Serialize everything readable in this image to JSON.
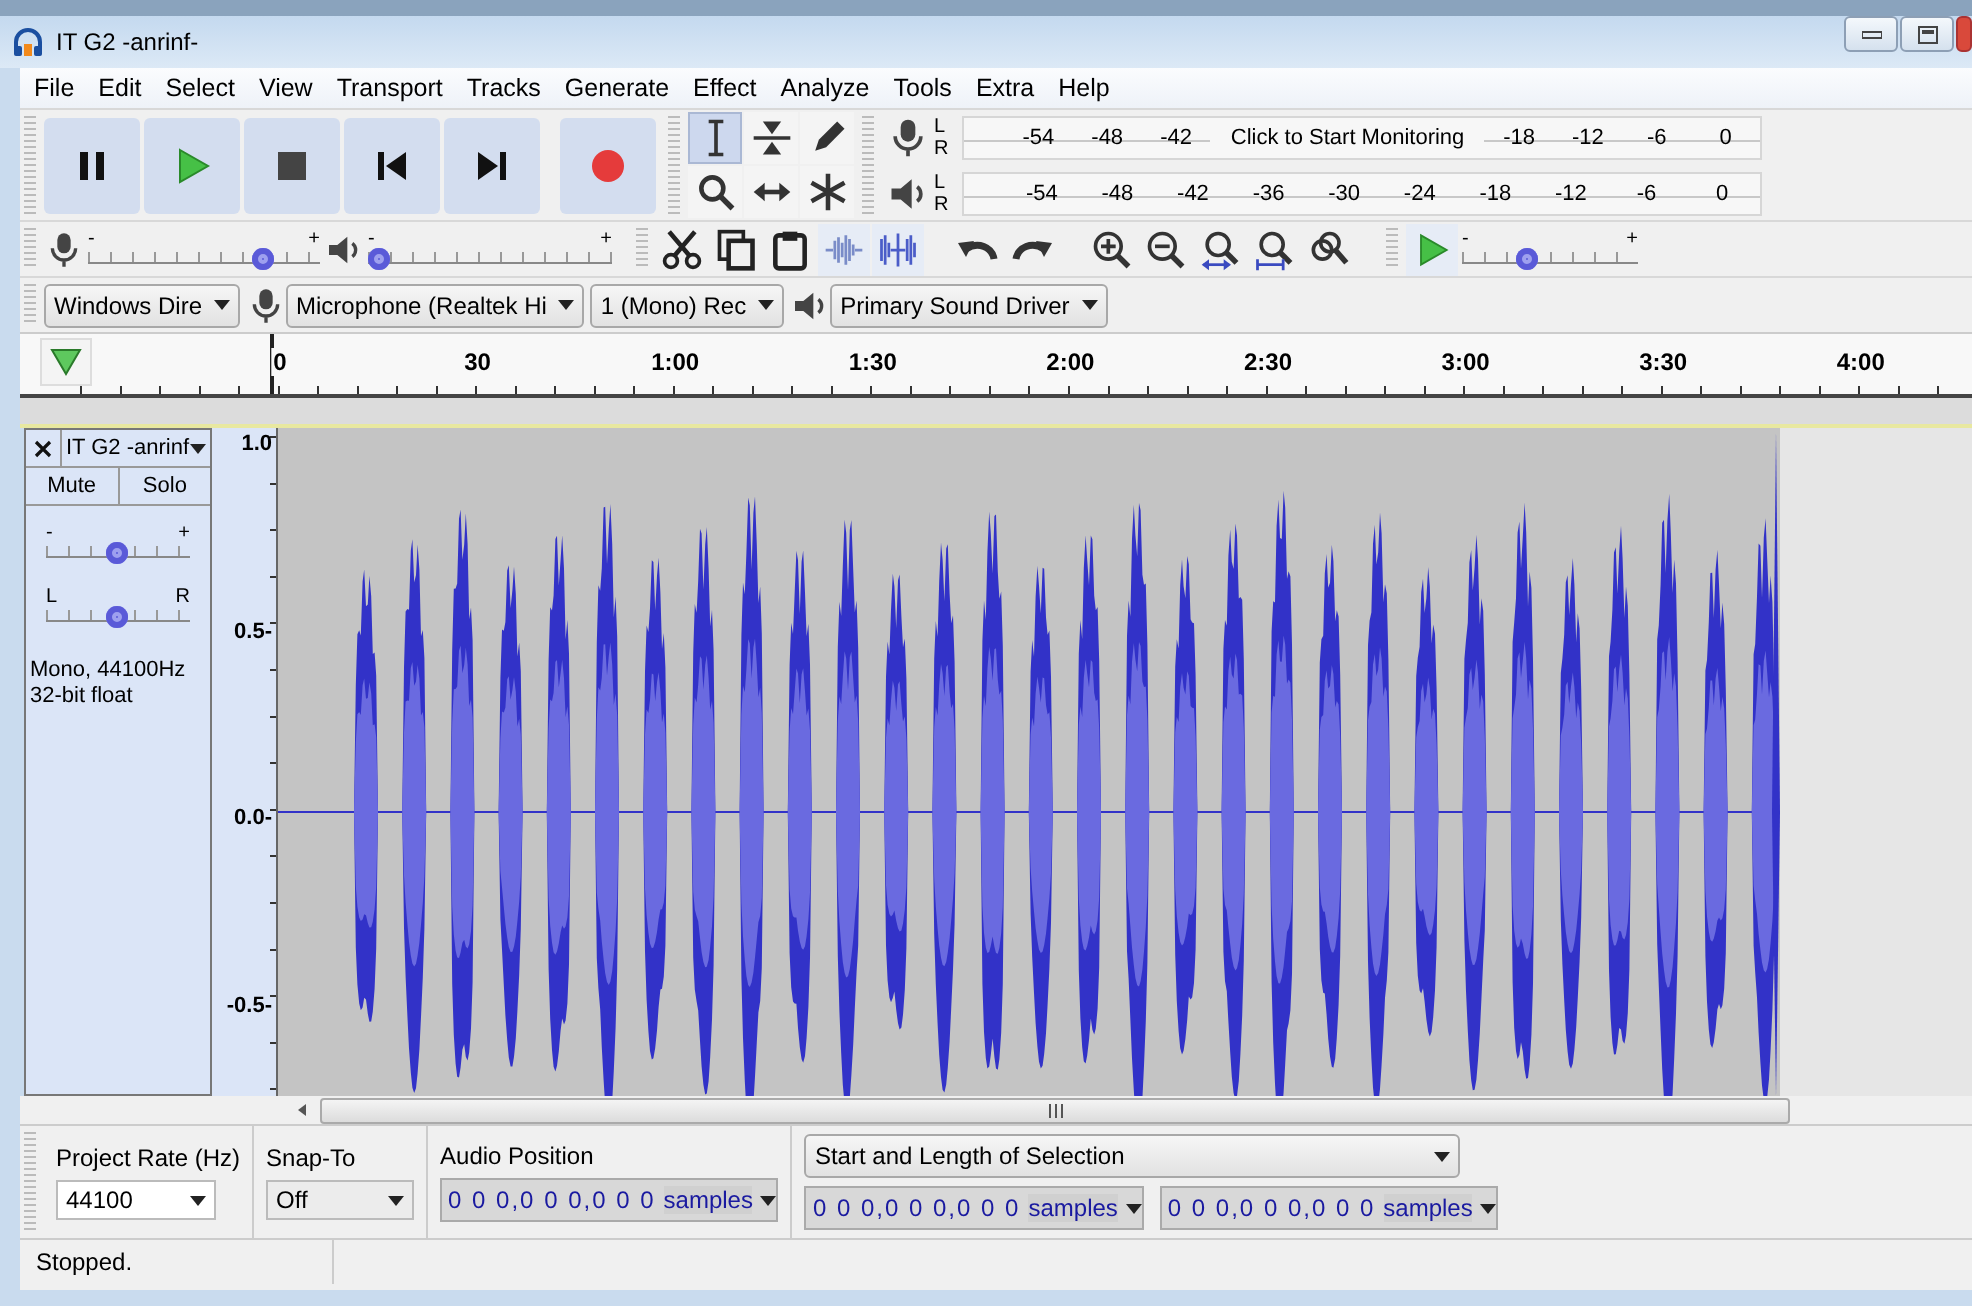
{
  "window": {
    "title": "IT G2 -anrinf-"
  },
  "menu": [
    "File",
    "Edit",
    "Select",
    "View",
    "Transport",
    "Tracks",
    "Generate",
    "Effect",
    "Analyze",
    "Tools",
    "Extra",
    "Help"
  ],
  "tools": [
    {
      "selected": true
    },
    {
      "selected": false
    },
    {
      "selected": false
    },
    {
      "selected": false
    },
    {
      "selected": false
    },
    {
      "selected": false
    }
  ],
  "meters": [
    {
      "kind": "record",
      "channels": [
        "L",
        "R"
      ],
      "labels_before": [
        "-54",
        "-48",
        "-42"
      ],
      "message": "Click to Start Monitoring",
      "labels_after": [
        "-18",
        "-12",
        "-6",
        "0"
      ]
    },
    {
      "kind": "playback",
      "channels": [
        "L",
        "R"
      ],
      "labels_before": [
        "-54",
        "-48",
        "-42",
        "-36",
        "-30",
        "-24",
        "-18",
        "-12",
        "-6",
        "0"
      ]
    }
  ],
  "mixer": [
    {
      "kind": "record",
      "min": "-",
      "max": "+",
      "level": 0.78
    },
    {
      "kind": "playback",
      "min": "-",
      "max": "+",
      "level": 0.0
    }
  ],
  "play_at_speed": {
    "min": "-",
    "max": "+",
    "level": 0.35
  },
  "devices": [
    {
      "kind": "host",
      "value": "Windows Dire"
    },
    {
      "kind": "input",
      "value": "Microphone (Realtek Hi"
    },
    {
      "kind": "channels",
      "value": "1 (Mono) Rec"
    },
    {
      "kind": "output",
      "value": "Primary Sound Driver"
    }
  ],
  "timeline": {
    "labels": [
      "0",
      "30",
      "1:00",
      "1:30",
      "2:00",
      "2:30",
      "3:00",
      "3:30",
      "4:00"
    ]
  },
  "track": {
    "name": "IT G2 -anrinf",
    "selected": true,
    "mute": "Mute",
    "solo": "Solo",
    "gain": {
      "min": "-",
      "max": "+",
      "level": 0.5
    },
    "pan": {
      "min": "L",
      "max": "R",
      "level": 0.5
    },
    "info": [
      "Mono, 44100Hz",
      "32-bit float"
    ],
    "scale": [
      "1.0",
      "0.5-",
      "0.0-",
      "-0.5-"
    ]
  },
  "selection_bar": {
    "project_rate": {
      "label": "Project Rate (Hz)",
      "value": "44100"
    },
    "snap_to": {
      "label": "Snap-To",
      "value": "Off"
    },
    "audio_position": {
      "label": "Audio Position",
      "value": "0 0 0,0 0 0,0 0 0",
      "unit": "samples"
    },
    "selection": {
      "mode": "Start and Length of Selection",
      "fields": [
        {
          "value": "0 0 0,0 0 0,0 0 0",
          "unit": "samples"
        },
        {
          "value": "0 0 0,0 0 0,0 0 0",
          "unit": "samples"
        }
      ]
    }
  },
  "status_bar": {
    "text": "Stopped."
  }
}
